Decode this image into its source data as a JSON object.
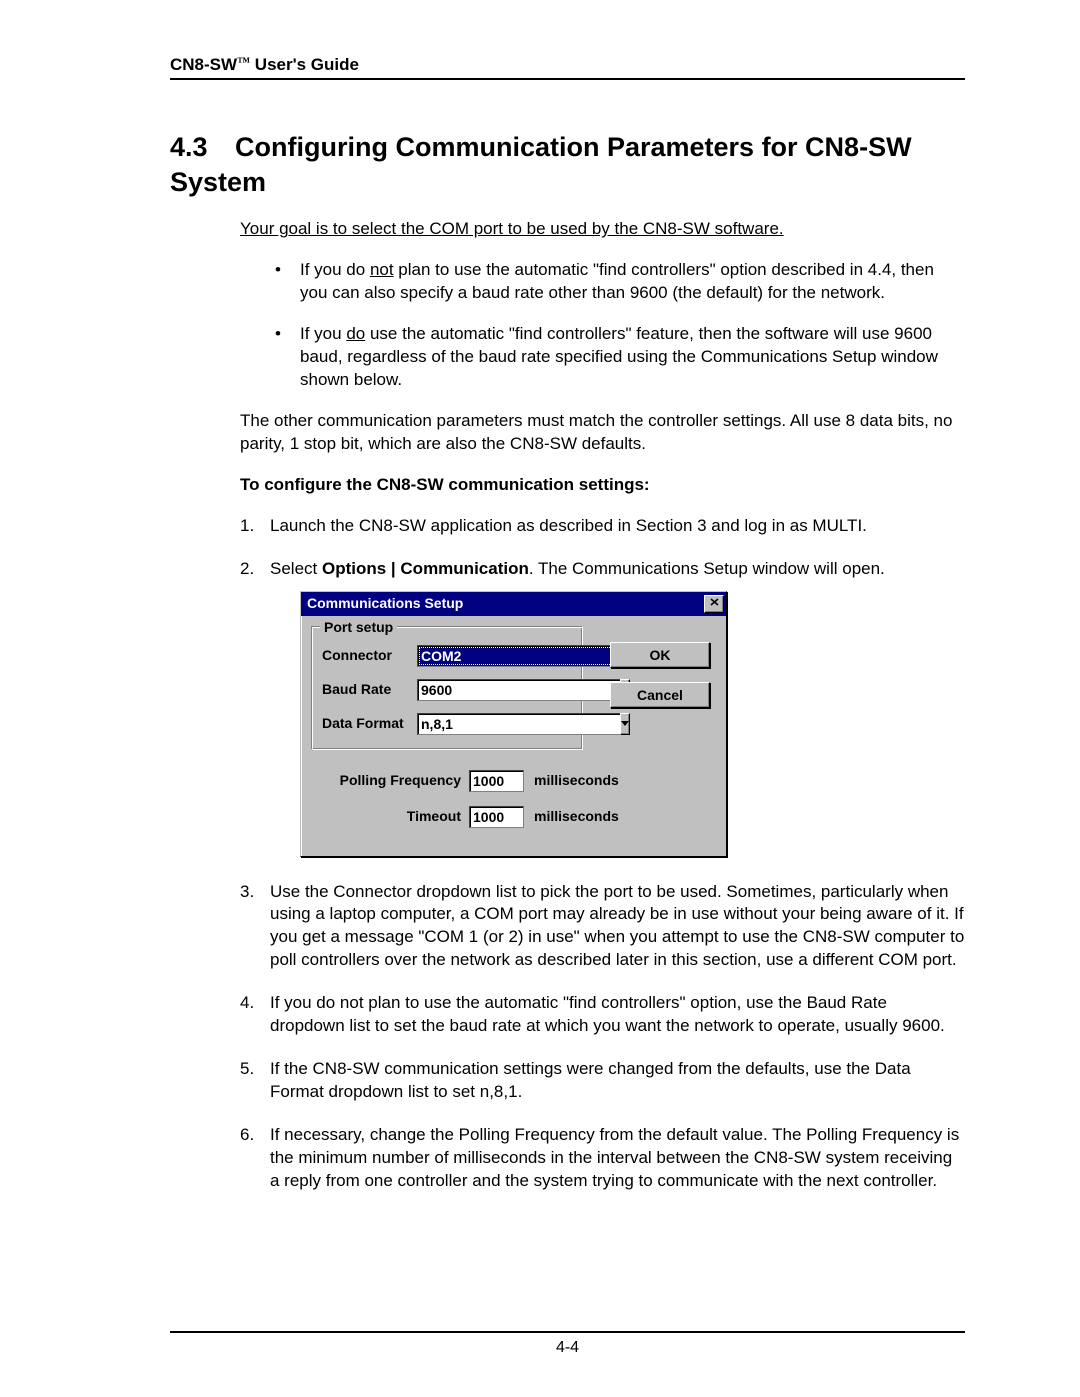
{
  "header": {
    "product": "CN8-SW",
    "tm": "™",
    "suffix": " User's Guide"
  },
  "title": {
    "number": "4.3",
    "text": "Configuring Communication Parameters for CN8-SW System"
  },
  "goal": "Your goal is to select the COM port to be used by the CN8-SW software",
  "goal_suffix": ".",
  "bullets": [
    {
      "pre": "If you do ",
      "u": "not",
      "post": " plan to use the automatic \"find controllers\" option described in 4.4, then you can also specify a baud rate other than 9600 (the default) for the network."
    },
    {
      "pre": "If you ",
      "u": "do",
      "post": " use the automatic \"find controllers\" feature, then the software will use 9600 baud, regardless of the baud rate specified using the Communications Setup window shown below."
    }
  ],
  "para_after_bullets": "The other communication parameters must match the controller settings.  All use 8 data bits, no parity, 1 stop bit, which are also the CN8-SW defaults.",
  "to_configure": "To configure the CN8-SW communication settings:",
  "steps": {
    "s1": "Launch the CN8-SW application as described in Section 3 and log in as MULTI.",
    "s2_pre": "Select ",
    "s2_bold": "Options | Communication",
    "s2_post": ".  The Communications Setup window will open.",
    "s3": "Use the Connector dropdown list to pick the port to be used.  Sometimes, particularly when using a laptop computer, a COM port may already be in use without your being aware of it.  If you get a message \"COM 1 (or 2) in use\" when you attempt to use the CN8-SW computer to poll controllers over the network as described later in this section, use a different COM port.",
    "s4": "If you do not plan to use the automatic \"find controllers\" option, use the Baud Rate dropdown list to set the baud rate at which you want the network to operate, usually 9600.",
    "s5": "If the CN8-SW communication settings were changed from the defaults, use the Data Format dropdown list to set n,8,1.",
    "s6": "If necessary, change the Polling Frequency from the default value.  The Polling Frequency is the minimum number of milliseconds in the interval between the CN8-SW system receiving a reply from one controller and the system trying to communicate with the next controller."
  },
  "dialog": {
    "title": "Communications Setup",
    "group_legend": "Port setup",
    "connector_label": "Connector",
    "connector_value": "COM2",
    "baud_label": "Baud Rate",
    "baud_value": "9600",
    "dataformat_label": "Data Format",
    "dataformat_value": "n,8,1",
    "ok": "OK",
    "cancel": "Cancel",
    "polling_label": "Polling Frequency",
    "polling_value": "1000",
    "timeout_label": "Timeout",
    "timeout_value": "1000",
    "unit": "milliseconds"
  },
  "footer": "4-4"
}
